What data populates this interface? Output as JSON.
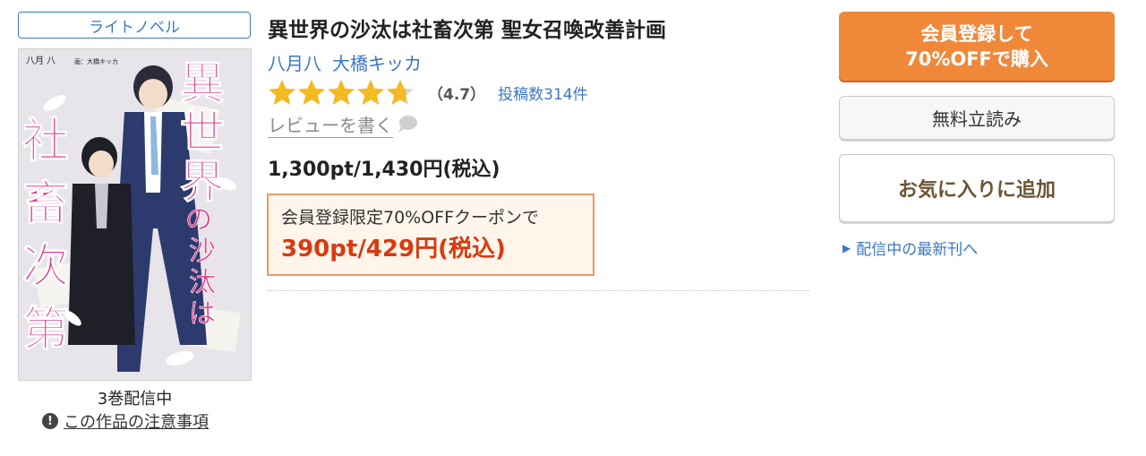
{
  "category_badge": "ライトノベル",
  "cover": {
    "author_small": "八月 八",
    "illustrator_small": "画：大橋キッカ",
    "title_vertical_1": "異世界",
    "title_vertical_2": "社畜次第",
    "title_small": "の沙汰は"
  },
  "volumes": "3巻配信中",
  "notice": "この作品の注意事項",
  "book": {
    "title": "異世界の沙汰は社畜次第 聖女召喚改善計画",
    "authors": [
      "八月八",
      "大橋キッカ"
    ],
    "rating": 4.7,
    "rating_label": "（4.7）",
    "reviews_label": "投稿数314件",
    "write_review": "レビューを書く",
    "price": "1,300pt/1,430円(税込)",
    "coupon_line1": "会員登録限定70%OFFクーポンで",
    "coupon_price": "390pt/429円(税込)"
  },
  "actions": {
    "buy_line1": "会員登録して",
    "buy_line2": "70%OFFで購入",
    "free_read": "無料立読み",
    "favorite": "お気に入りに追加",
    "latest": "配信中の最新刊へ"
  },
  "colors": {
    "accent_blue": "#3c77c3",
    "buy_orange": "#f0883a",
    "coupon_red": "#d93a0f",
    "star_gold": "#f5b921"
  }
}
